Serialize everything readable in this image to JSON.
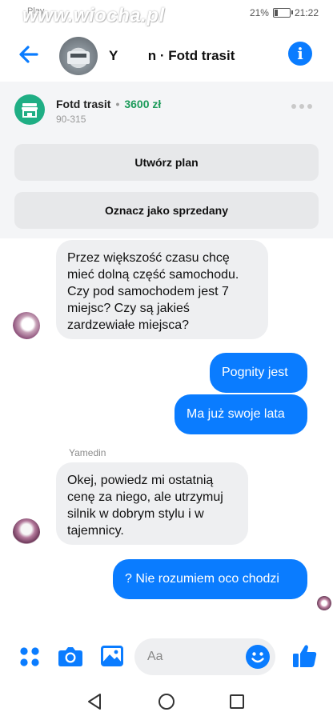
{
  "status_bar": {
    "carrier": "Play",
    "watermark": "www.wiocha.pl",
    "battery": "21%",
    "time": "21:22"
  },
  "header": {
    "title": "Y           n · Fotd trasit"
  },
  "listing": {
    "title": "Fotd trasit",
    "price": "3600 zł",
    "postal_code": "90-315",
    "create_plan_label": "Utwórz plan",
    "mark_sold_label": "Oznacz jako sprzedany"
  },
  "messages": [
    {
      "direction": "in",
      "lines": [
        "Przez większość czasu chcę",
        "mieć dolną część samochodu.",
        "Czy pod samochodem jest 7",
        "miejsc? Czy są jakieś",
        "zardzewiałe miejsca?"
      ]
    },
    {
      "direction": "out",
      "text": "Pognity jest"
    },
    {
      "direction": "out",
      "text": "Ma już swoje lata"
    },
    {
      "direction": "in",
      "sender": "Yamedin",
      "lines": [
        "Okej, powiedz mi ostatnią",
        "cenę za niego, ale utrzymuj",
        "silnik w dobrym stylu i w",
        "tajemnicy."
      ]
    },
    {
      "direction": "out",
      "text": "? Nie rozumiem oco chodzi"
    }
  ],
  "composer": {
    "placeholder": "Aa"
  },
  "icons": {
    "back": "arrow-left-icon",
    "info": "info-icon",
    "apps": "four-dots-icon",
    "camera": "camera-icon",
    "gallery": "image-icon",
    "emoji": "smiley-icon",
    "like": "thumbs-up-icon",
    "nav_back": "triangle-back-icon",
    "nav_home": "circle-home-icon",
    "nav_recent": "square-recent-icon"
  },
  "colors": {
    "accent": "#0a7cff",
    "price": "#1d9b5b",
    "shop_icon": "#1fae84",
    "bubble_in": "#eeeff1"
  }
}
